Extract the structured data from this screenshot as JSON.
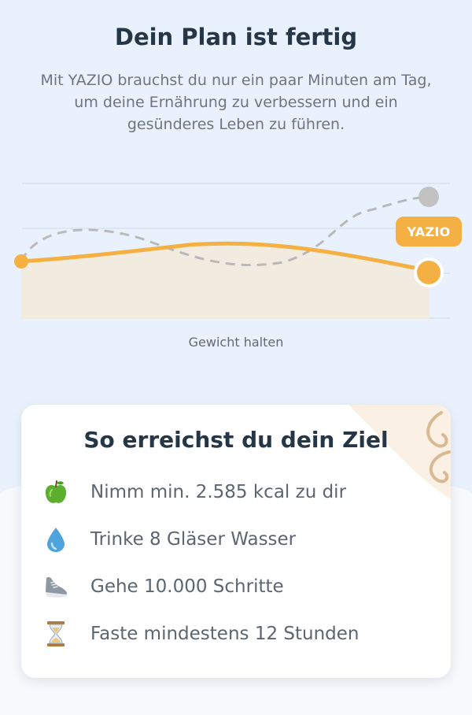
{
  "header": {
    "title": "Dein Plan ist fertig",
    "subtitle": "Mit YAZIO brauchst du nur ein paar Minuten am Tag, um deine Ernährung zu verbessern und ein gesünderes Leben zu führen."
  },
  "chart": {
    "caption": "Gewicht halten",
    "badge": "YAZIO",
    "colors": {
      "yazio_line": "#f5b044",
      "other_line": "#b9b9b9",
      "fill": "#f2ece0"
    }
  },
  "card": {
    "title": "So erreichst du dein Ziel",
    "items": [
      {
        "icon": "apple-icon",
        "label": "Nimm min. 2.585 kcal zu dir"
      },
      {
        "icon": "water-drop-icon",
        "label": "Trinke 8 Gläser Wasser"
      },
      {
        "icon": "sneaker-icon",
        "label": "Gehe 10.000 Schritte"
      },
      {
        "icon": "hourglass-icon",
        "label": "Faste mindestens 12 Stunden"
      }
    ]
  }
}
